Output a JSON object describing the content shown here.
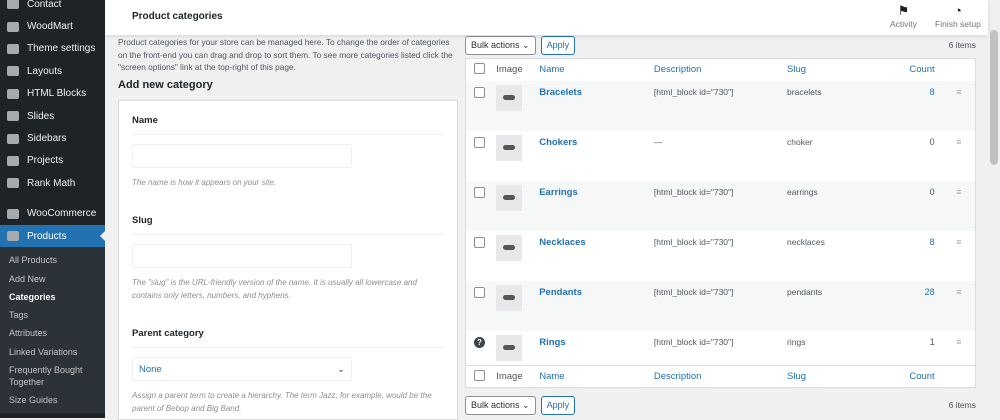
{
  "sidebar": {
    "items": [
      {
        "label": "Contact",
        "icon": "envelope-icon"
      },
      {
        "label": "WoodMart",
        "icon": "woodmart-icon"
      },
      {
        "label": "Theme settings",
        "icon": "sliders-icon"
      },
      {
        "label": "Layouts",
        "icon": "layers-icon"
      },
      {
        "label": "HTML Blocks",
        "icon": "html-icon"
      },
      {
        "label": "Slides",
        "icon": "slides-icon"
      },
      {
        "label": "Sidebars",
        "icon": "sidebar-icon"
      },
      {
        "label": "Projects",
        "icon": "briefcase-icon"
      },
      {
        "label": "Rank Math",
        "icon": "chart-icon"
      },
      {
        "label": "WooCommerce",
        "icon": "woo-icon"
      },
      {
        "label": "Products",
        "icon": "box-icon"
      }
    ],
    "submenu": [
      "All Products",
      "Add New",
      "Categories",
      "Tags",
      "Attributes",
      "Linked Variations",
      "Frequently Bought Together",
      "Size Guides"
    ],
    "active_submenu": "Categories",
    "accent": "#2271b1"
  },
  "header": {
    "title": "Product categories",
    "activity": "Activity",
    "finish_setup": "Finish setup"
  },
  "intro": "Product categories for your store can be managed here. To change the order of categories on the front-end you can drag and drop to sort them. To see more categories listed click the \"screen options\" link at the top-right of this page.",
  "form": {
    "heading": "Add new category",
    "name_label": "Name",
    "name_value": "",
    "name_help": "The name is how it appears on your site.",
    "slug_label": "Slug",
    "slug_value": "",
    "slug_help": "The \"slug\" is the URL-friendly version of the name. It is usually all lowercase and contains only letters, numbers, and hyphens.",
    "parent_label": "Parent category",
    "parent_value": "None",
    "parent_help": "Assign a parent term to create a hierarchy. The term Jazz, for example, would be the parent of Bebop and Big Band."
  },
  "table": {
    "bulk_actions": "Bulk actions",
    "apply": "Apply",
    "items_count": "6 items",
    "columns": [
      "Image",
      "Name",
      "Description",
      "Slug",
      "Count"
    ],
    "rows": [
      {
        "name": "Bracelets",
        "description": "[html_block id=\"730\"]",
        "slug": "bracelets",
        "count": "8"
      },
      {
        "name": "Chokers",
        "description": "—",
        "slug": "choker",
        "count": "0"
      },
      {
        "name": "Earrings",
        "description": "[html_block id=\"730\"]",
        "slug": "earrings",
        "count": "0"
      },
      {
        "name": "Necklaces",
        "description": "[html_block id=\"730\"]",
        "slug": "necklaces",
        "count": "8"
      },
      {
        "name": "Pendants",
        "description": "[html_block id=\"730\"]",
        "slug": "pendants",
        "count": "28"
      },
      {
        "name": "Rings",
        "description": "[html_block id=\"730\"]",
        "slug": "rings",
        "count": "1"
      }
    ]
  }
}
